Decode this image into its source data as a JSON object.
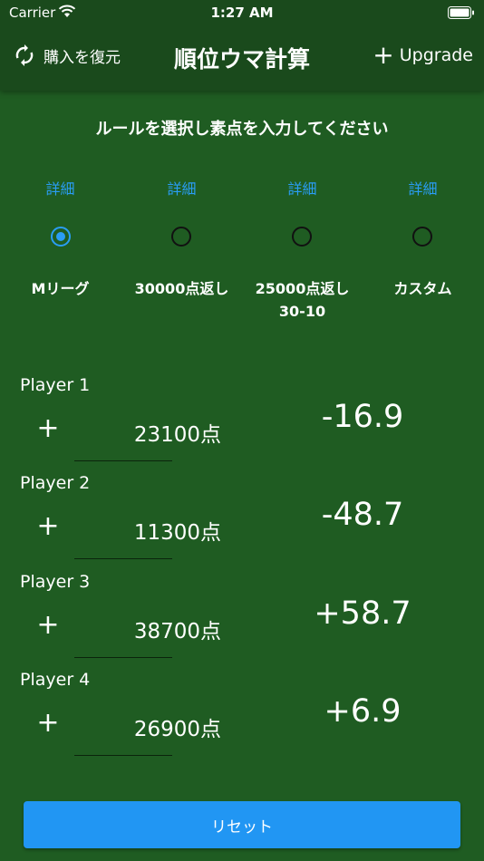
{
  "status_bar": {
    "carrier": "Carrier",
    "time": "1:27 AM"
  },
  "nav": {
    "restore_label": "購入を復元",
    "title": "順位ウマ計算",
    "upgrade_label": "Upgrade",
    "upgrade_plus": "+"
  },
  "instruction": "ルールを選択し素点を入力してください",
  "rules": [
    {
      "detail": "詳細",
      "label": "Mリーグ",
      "selected": true
    },
    {
      "detail": "詳細",
      "label": "30000点返し",
      "selected": false
    },
    {
      "detail": "詳細",
      "label_line1": "25000点返し",
      "label_line2": "30-10",
      "selected": false
    },
    {
      "detail": "詳細",
      "label": "カスタム",
      "selected": false
    }
  ],
  "players": [
    {
      "name": "Player 1",
      "plus": "+",
      "score": "231",
      "suffix": "00点",
      "result": "-16.9"
    },
    {
      "name": "Player 2",
      "plus": "+",
      "score": "113",
      "suffix": "00点",
      "result": "-48.7"
    },
    {
      "name": "Player 3",
      "plus": "+",
      "score": "387",
      "suffix": "00点",
      "result": "+58.7"
    },
    {
      "name": "Player 4",
      "plus": "+",
      "score": "269",
      "suffix": "00点",
      "result": "+6.9"
    }
  ],
  "reset_label": "リセット",
  "icons": [
    "wifi-icon",
    "battery-icon",
    "refresh-icon",
    "plus-icon"
  ]
}
